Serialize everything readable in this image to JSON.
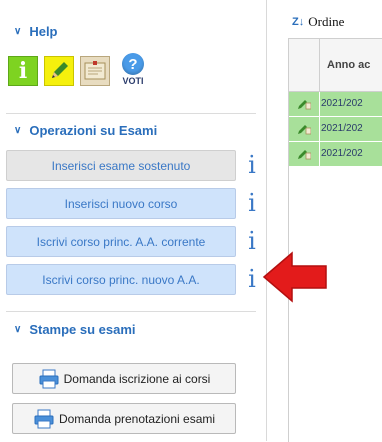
{
  "sidebar": {
    "help": {
      "title": "Help",
      "icons": [
        {
          "name": "info-icon",
          "glyph": "i"
        },
        {
          "name": "pencil-icon"
        },
        {
          "name": "notebook-icon"
        }
      ],
      "voti": {
        "glyph": "?",
        "label": "VOTI"
      }
    },
    "operazioni": {
      "title": "Operazioni su Esami",
      "buttons": [
        {
          "label": "Inserisci esame sostenuto",
          "disabled": true
        },
        {
          "label": "Inserisci nuovo corso",
          "disabled": false
        },
        {
          "label": "Iscrivi corso princ. A.A. corrente",
          "disabled": false
        },
        {
          "label": "Iscrivi corso princ. nuovo A.A.",
          "disabled": false
        }
      ],
      "info_glyph": "i"
    },
    "stampe": {
      "title": "Stampe su esami",
      "buttons": [
        {
          "label": "Domanda iscrizione ai corsi"
        },
        {
          "label": "Domanda prenotazioni esami"
        }
      ]
    }
  },
  "table": {
    "sort_label": "Ordine",
    "sort_icon": "Z↓",
    "header_col": "Anno ac",
    "rows": [
      {
        "year": "2021/202"
      },
      {
        "year": "2021/202"
      },
      {
        "year": "2021/202"
      }
    ]
  },
  "colors": {
    "accent": "#2a6ebb",
    "button_bg": "#cfe3fb",
    "disabled_bg": "#e6e6e6",
    "row_green": "#a8e09a",
    "arrow_red": "#e31b1b"
  }
}
